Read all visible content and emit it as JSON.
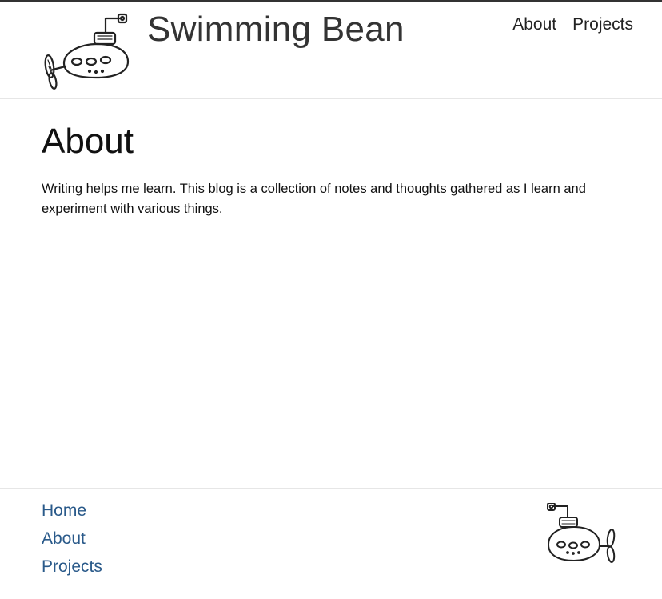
{
  "header": {
    "site_title": "Swimming Bean",
    "logo_icon": "submarine-icon",
    "nav": [
      {
        "label": "About"
      },
      {
        "label": "Projects"
      }
    ]
  },
  "main": {
    "heading": "About",
    "body": "Writing helps me learn. This blog is a collection of notes and thoughts gathered as I learn and experiment with various things."
  },
  "footer": {
    "links": [
      {
        "label": "Home"
      },
      {
        "label": "About"
      },
      {
        "label": "Projects"
      }
    ],
    "logo_icon": "submarine-icon"
  },
  "colors": {
    "text": "#222222",
    "title": "#333333",
    "footer_link": "#2a5a8a",
    "divider": "#e6e6e6",
    "top_bar": "#333333"
  }
}
